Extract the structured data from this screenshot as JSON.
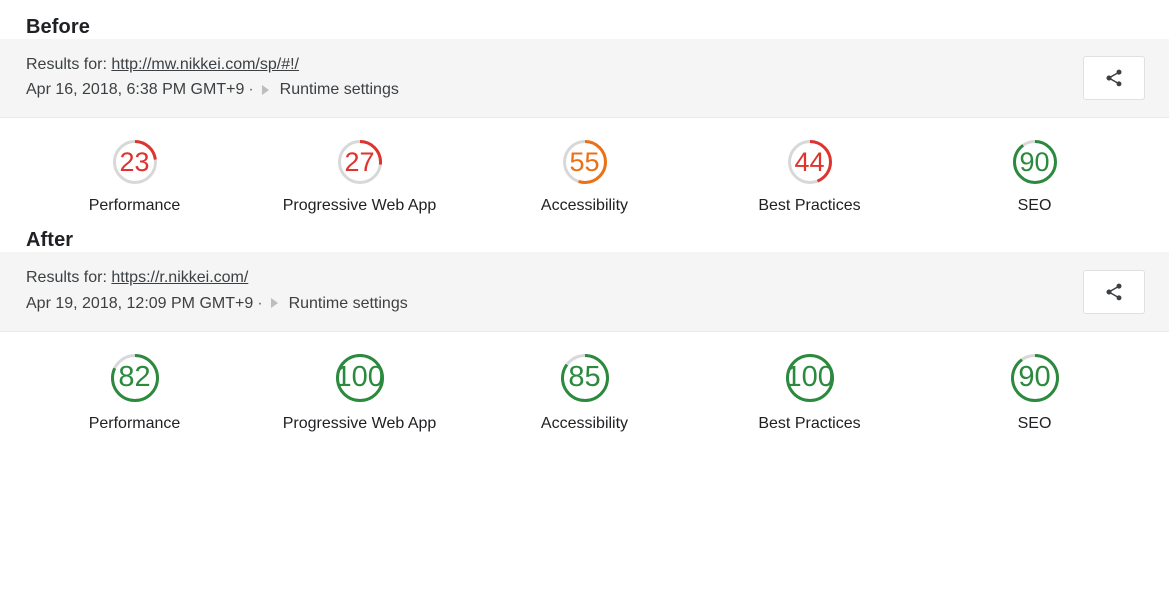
{
  "sections": [
    {
      "heading": "Before",
      "header": {
        "results_label": "Results for:",
        "url": "http://mw.nikkei.com/sp/#!/",
        "timestamp": "Apr 16, 2018, 6:38 PM GMT+9",
        "separator": "·",
        "runtime_settings": "Runtime settings",
        "share_button_name": "share-icon"
      },
      "gauge_size": 44,
      "gauge_stroke": 3,
      "scores": [
        {
          "label": "Performance",
          "value": 23,
          "display": "23",
          "color": "#df332f"
        },
        {
          "label": "Progressive Web App",
          "value": 27,
          "display": "27",
          "color": "#df332f"
        },
        {
          "label": "Accessibility",
          "value": 55,
          "display": "55",
          "color": "#ed7014"
        },
        {
          "label": "Best Practices",
          "value": 44,
          "display": "44",
          "color": "#df332f"
        },
        {
          "label": "SEO",
          "value": 90,
          "display": "90",
          "color": "#2b8a3e"
        }
      ]
    },
    {
      "heading": "After",
      "header": {
        "results_label": "Results for:",
        "url": "https://r.nikkei.com/",
        "timestamp": "Apr 19, 2018, 12:09 PM GMT+9",
        "separator": "·",
        "runtime_settings": "Runtime settings",
        "share_button_name": "share-icon"
      },
      "gauge_size": 48,
      "gauge_stroke": 3,
      "scores": [
        {
          "label": "Performance",
          "value": 82,
          "display": "82",
          "color": "#2b8a3e"
        },
        {
          "label": "Progressive Web App",
          "value": 100,
          "display": "100",
          "color": "#2b8a3e"
        },
        {
          "label": "Accessibility",
          "value": 85,
          "display": "85",
          "color": "#2b8a3e"
        },
        {
          "label": "Best Practices",
          "value": 100,
          "display": "100",
          "color": "#2b8a3e"
        },
        {
          "label": "SEO",
          "value": 90,
          "display": "90",
          "color": "#2b8a3e"
        }
      ]
    }
  ],
  "colors": {
    "track": "#d8d8d8",
    "red": "#df332f",
    "orange": "#ed7014",
    "green": "#2b8a3e",
    "band": "#f5f5f5",
    "text": "#3c4043"
  }
}
